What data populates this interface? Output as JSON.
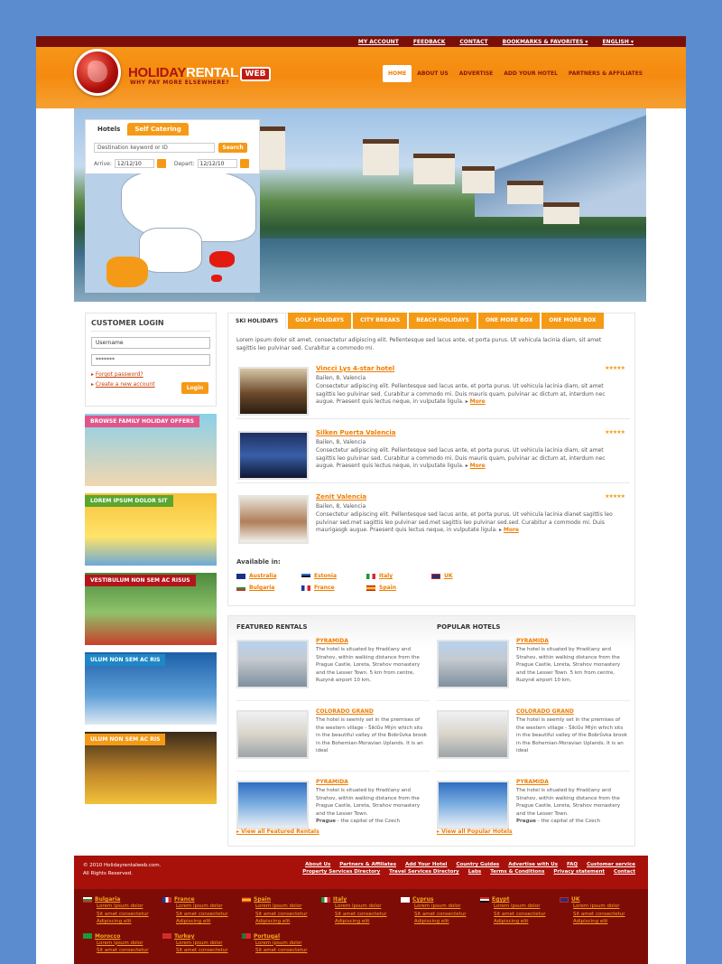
{
  "top_links": [
    "MY ACCOUNT",
    "FEEDBACK",
    "CONTACT",
    "BOOKMARKS & FAVORITES ▾",
    "ENGLISH ▾"
  ],
  "logo": {
    "holiday": "HOLIDAY",
    "rental": "RENTAL",
    "web": "WEB",
    "tagline": "WHY PAY MORE ELSEWHERE?"
  },
  "main_nav": [
    "HOME",
    "ABOUT US",
    "ADVERTISE",
    "ADD YOUR HOTEL",
    "PARTNERS & AFFILIATES"
  ],
  "search": {
    "tab_hotels": "Hotels",
    "tab_self": "Self Catering",
    "placeholder": "Destination keyword or ID",
    "button": "Search",
    "arrive_label": "Arrive:",
    "arrive": "12/12/10",
    "depart_label": "Depart:",
    "depart": "12/12/10"
  },
  "login": {
    "title": "CUSTOMER LOGIN",
    "username": "Username",
    "password": "*******",
    "forgot": "Forgot password?",
    "create": "Create a new account",
    "button": "Login"
  },
  "promos": [
    {
      "label": "BROWSE FAMILY HOLIDAY OFFERS",
      "color": "#e0558a"
    },
    {
      "label": "LOREM IPSUM DOLOR SIT",
      "color": "#5aa62e"
    },
    {
      "label": "VESTIBULUM NON SEM AC RISUS",
      "color": "#b3151a"
    },
    {
      "label": "ULUM NON SEM AC RIS",
      "color": "#1e88c7"
    },
    {
      "label": "ULUM NON SEM AC RIS",
      "color": "#f59a16"
    }
  ],
  "tabs": [
    "SKI HOLIDAYS",
    "GOLF HOLIDAYS",
    "CITY BREAKS",
    "BEACH HOLIDAYS",
    "ONE MORE BOX",
    "ONE MORE BOX"
  ],
  "intro": "Lorem ipsum dolor sit amet, consectetur adipiscing elit. Pellentesque sed lacus ante, et porta purus. Ut vehicula lacinia diam, sit amet sagittis leo pulvinar sed. Curabitur a commodo mi.",
  "hotels": [
    {
      "name": "Vincci Lys 4-star hotel",
      "addr": "Bailen, 8, Valencia",
      "desc": "Consectetur adipiscing elit. Pellentesque sed lacus ante, et porta purus. Ut vehicula lacinia diam, sit amet sagittis leo pulvinar sed. Curabitur a commodo mi. Duis mauris quam, pulvinar ac dictum at, interdum nec augue. Praesent quis lectus neque, in vulputate ligula.",
      "more": "More"
    },
    {
      "name": "Silken Puerta Valencia",
      "addr": "Bailen, 8, Valencia",
      "desc": "Consectetur adipiscing elit. Pellentesque sed lacus ante, et porta purus. Ut vehicula lacinia diam, sit amet sagittis leo pulvinar sed. Curabitur a commodo mi. Duis mauris quam, pulvinar ac dictum at, interdum nec augue. Praesent quis lectus neque, in vulputate ligula.",
      "more": "More"
    },
    {
      "name": "Zenit Valencia",
      "addr": "Bailen, 8, Valencia",
      "desc": "Consectetur adipiscing elit. Pellentesque sed lacus ante, et porta purus. Ut vehicula lacinia dianet sagittis leo pulvinar sed.met sagittis leo pulvinar sed.met sagittis leo pulvinar sed.sed. Curabitur a commodo mi. Duis maurigasgk augue. Praesent quis lectus neque, in vulputate ligula.",
      "more": "More"
    }
  ],
  "stars": "★★★★★",
  "available_label": "Available in:",
  "countries": [
    "Australia",
    "Estonia",
    "Italy",
    "UK",
    "Bulgaria",
    "France",
    "Spain"
  ],
  "featured_title": "FEATURED RENTALS",
  "popular_title": "POPULAR HOTELS",
  "rentals": [
    {
      "name": "PYRAMIDA",
      "desc": "The hotel is situated by Hradčany and Strahov, within walking distance from the Prague Castle, Loreta, Strahov monastery and the Lesser Town. 5 km from centre, Ruzyně airport 10 km,"
    },
    {
      "name": "COLORADO GRAND",
      "desc": "The hotel is seemly set in the premises of the western village - Šiklův Mlýn which sits in the beautiful valley of the Bobrůvka brook in the Bohemian-Moravian Uplands. It is an ideal"
    },
    {
      "name": "PYRAMIDA",
      "desc": "The hotel is situated by Hradčany and Strahov, within walking distance from the Prague Castle, Loreta, Strahov monastery and the Lesser Town.",
      "bold": "Prague",
      "tail": " - the capital of the Czech"
    }
  ],
  "view_featured": "View all Featured Rentals",
  "view_popular": "View all Popular Hotels",
  "footer": {
    "copyright": "© 2010 Holidayrentalweb.com.",
    "rights": "All Rights Reserved.",
    "links": [
      "About Us",
      "Partners & Affiliates",
      "Add Your Hotel",
      "Country Guides",
      "Advertise with Us",
      "FAQ",
      "Customer service",
      "Property Services Directory",
      "Travel Services Directory",
      "Labs",
      "Terms & Conditions",
      "Privacy statement",
      "Contact"
    ],
    "countries": [
      "Bulgaria",
      "France",
      "Spain",
      "Italy",
      "Cyprus",
      "Egypt",
      "UK",
      "Morocco",
      "Turkey",
      "Portugal"
    ],
    "sub": [
      "Lorem ipsum dolor",
      "Sit amet consectetur",
      "Adipiscing elit"
    ]
  }
}
